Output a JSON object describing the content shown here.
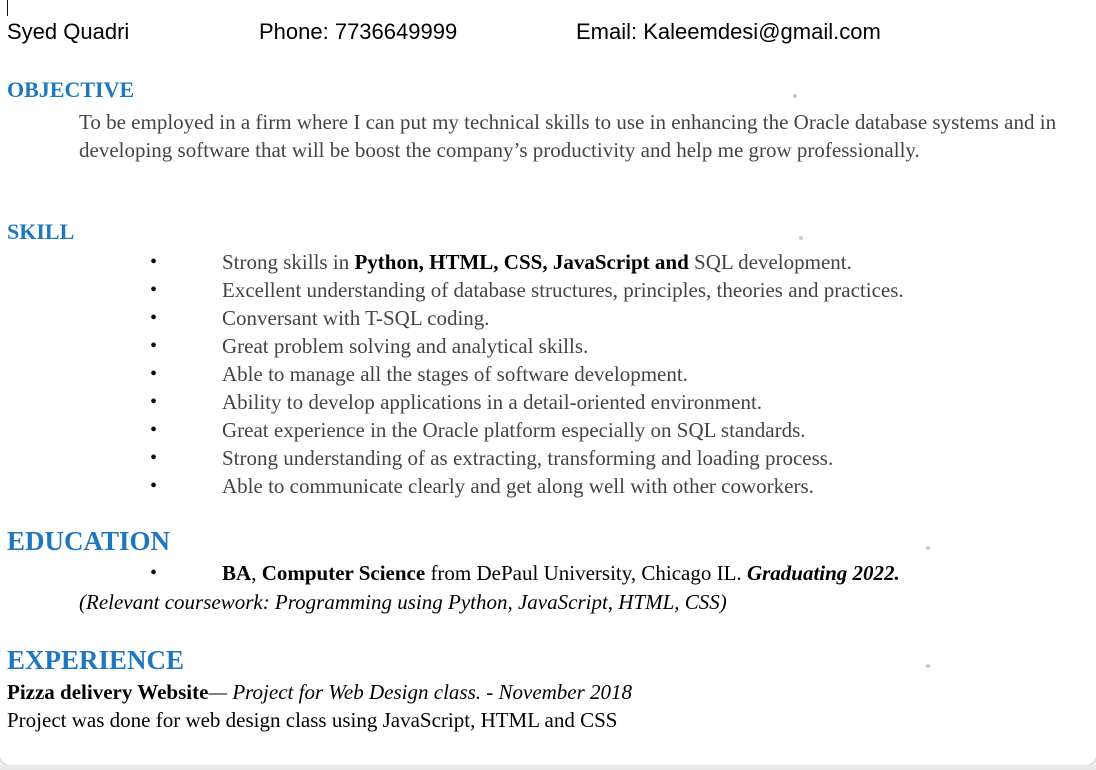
{
  "contact": {
    "name": "Syed Quadri",
    "phone": "Phone: 7736649999",
    "email": "Email: Kaleemdesi@gmail.com"
  },
  "objective": {
    "heading": "OBJECTIVE",
    "text": "To be employed in a firm where I can put my technical skills to use in enhancing the Oracle database systems and in developing software that will be boost the company’s productivity and help me grow professionally."
  },
  "skill": {
    "heading": "SKILL",
    "bullet_glyph": "•",
    "first_prefix": "Strong skills in ",
    "first_bold": "Python, HTML, CSS, JavaScript and",
    "first_suffix": " SQL development.",
    "items": [
      "Excellent understanding of database structures, principles, theories and practices.",
      "Conversant with T-SQL coding.",
      "Great problem solving and analytical skills.",
      "Able to manage all the stages of software development.",
      "Ability to develop applications in a detail-oriented environment.",
      "Great experience in the Oracle platform especially on SQL standards.",
      "Strong understanding of as extracting, transforming and loading process.",
      "Able to communicate clearly and get along well with other coworkers."
    ]
  },
  "education": {
    "heading": "EDUCATION",
    "degree": "BA",
    "sep": ", ",
    "major": "Computer Science",
    "school": " from DePaul University, Chicago IL. ",
    "graduation": "Graduating 2022.",
    "coursework": "(Relevant coursework: Programming using Python, JavaScript, HTML, CSS)"
  },
  "experience": {
    "heading": "EXPERIENCE",
    "title": "Pizza delivery Website",
    "title_note": "— Project for Web Design class. - November 2018",
    "description": "Project was done for web design class using JavaScript, HTML and CSS"
  },
  "colors": {
    "heading": "#1f77bd",
    "body_text": "#444444"
  }
}
